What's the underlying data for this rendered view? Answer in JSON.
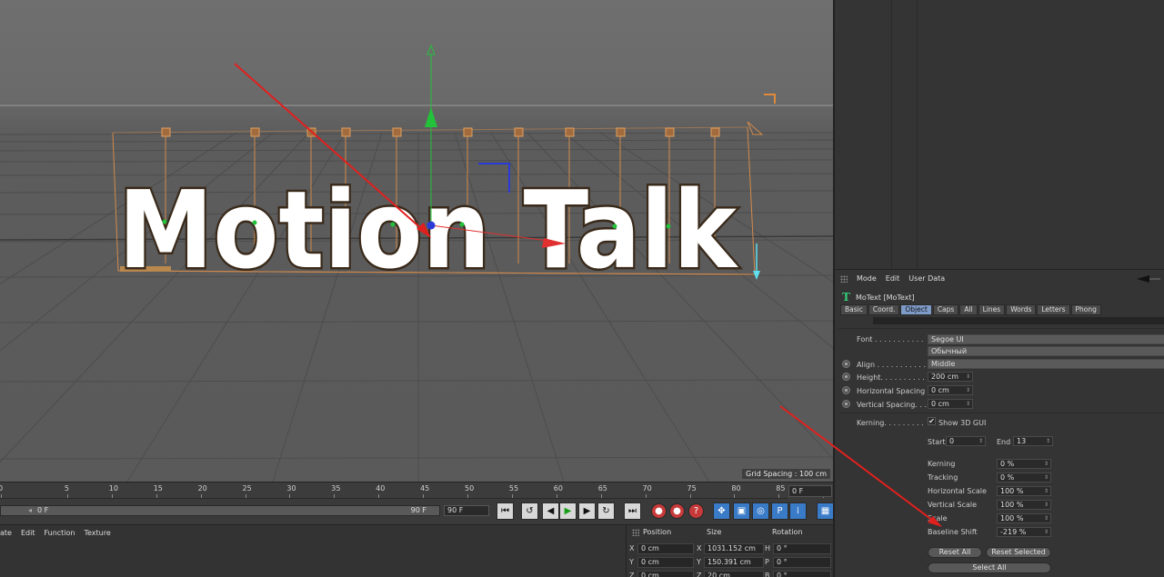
{
  "viewport": {
    "grid_label": "Grid Spacing : 100 cm",
    "scene_text": "Motion Talk"
  },
  "timeline": {
    "ticks": [
      "0",
      "5",
      "10",
      "15",
      "20",
      "25",
      "30",
      "35",
      "40",
      "45",
      "50",
      "55",
      "60",
      "65",
      "70",
      "75",
      "80",
      "85",
      "90"
    ],
    "frame_end_box": "0 F",
    "scrub_start": "0 F",
    "scrub_end": "90 F",
    "end_frame_field": "90 F",
    "transport_icons": [
      "go-to-start-icon",
      "prev-key-icon",
      "step-back-icon",
      "play-icon",
      "step-forward-icon",
      "next-key-icon",
      "go-to-end-icon"
    ],
    "record_icons": [
      "record-icon",
      "autokey-icon",
      "keyframe-selection-icon"
    ],
    "tool_icons": [
      "move-icon",
      "scale-icon",
      "rotate-icon",
      "param-icon",
      "grid-points-icon",
      "film-icon"
    ]
  },
  "material_bar": {
    "menu": [
      "ate",
      "Edit",
      "Function",
      "Texture"
    ]
  },
  "coords": {
    "headers": {
      "position": "Position",
      "size": "Size",
      "rotation": "Rotation"
    },
    "rows": [
      {
        "axis": "X",
        "pos": "0 cm",
        "saxis": "X",
        "size": "1031.152 cm",
        "raxis": "H",
        "rot": "0 °"
      },
      {
        "axis": "Y",
        "pos": "0 cm",
        "saxis": "Y",
        "size": "150.391 cm",
        "raxis": "P",
        "rot": "0 °"
      },
      {
        "axis": "Z",
        "pos": "0 cm",
        "saxis": "Z",
        "size": "20 cm",
        "raxis": "B",
        "rot": "0 °"
      }
    ]
  },
  "attributes": {
    "menu": [
      "Mode",
      "Edit",
      "User Data"
    ],
    "object_title": "MoText [MoText]",
    "tabs": [
      "Basic",
      "Coord.",
      "Object",
      "Caps",
      "All",
      "Lines",
      "Words",
      "Letters",
      "Phong"
    ],
    "active_tab": "Object",
    "font_label": "Font . . . . . . . . . . .",
    "font_value": "Segoe UI",
    "font_style": "Обычный",
    "align_label": "Align . . . . . . . . . . . .",
    "align_value": "Middle",
    "height_label": "Height. . . . . . . . . . .",
    "height_value": "200 cm",
    "hspacing_label": "Horizontal Spacing",
    "hspacing_value": "0 cm",
    "vspacing_label": "Vertical Spacing. . .",
    "vspacing_value": "0 cm",
    "kerning_label": "Kerning. . . . . . . . .",
    "show3d_label": "Show 3D GUI",
    "show3d_checked": "✔",
    "start_label": "Start",
    "start_value": "0",
    "end_label": "End",
    "end_value": "13",
    "kern_props": [
      {
        "label": "Kerning",
        "value": "0 %"
      },
      {
        "label": "Tracking",
        "value": "0 %"
      },
      {
        "label": "Horizontal Scale",
        "value": "100 %"
      },
      {
        "label": "Vertical Scale",
        "value": "100 %"
      },
      {
        "label": "Scale",
        "value": "100 %"
      },
      {
        "label": "Baseline Shift",
        "value": "-219 %"
      }
    ],
    "reset_all": "Reset All",
    "reset_selected": "Reset Selected",
    "select_all": "Select All"
  },
  "colors": {
    "arrow_red": "#e0201e",
    "axis_green": "#22c33a",
    "axis_red": "#e03030",
    "axis_blue": "#2a3ad8",
    "handle_orange": "#d28a4c",
    "active_tab": "#7e9bc8"
  }
}
